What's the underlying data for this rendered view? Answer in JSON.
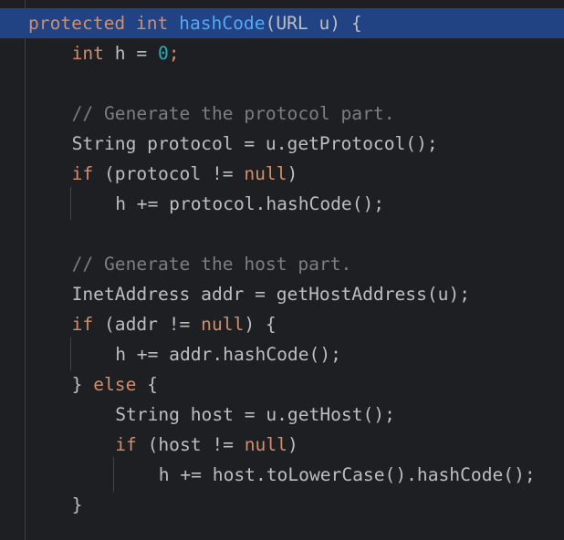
{
  "editor": {
    "lines": [
      {
        "id": "line-1",
        "current": true,
        "indent": 0,
        "tokens": [
          {
            "t": "protected",
            "c": "kw"
          },
          {
            "t": " ",
            "c": "pl"
          },
          {
            "t": "int",
            "c": "kw"
          },
          {
            "t": " ",
            "c": "pl"
          },
          {
            "t": "hashCode",
            "c": "fn"
          },
          {
            "t": "(URL u) {",
            "c": "pl"
          }
        ]
      },
      {
        "id": "line-2",
        "indent": 1,
        "tokens": [
          {
            "t": "int",
            "c": "kw"
          },
          {
            "t": " h = ",
            "c": "pl"
          },
          {
            "t": "0",
            "c": "num"
          },
          {
            "t": ";",
            "c": "kw"
          }
        ]
      },
      {
        "id": "line-3",
        "indent": 0,
        "tokens": []
      },
      {
        "id": "line-4",
        "indent": 1,
        "tokens": [
          {
            "t": "// Generate the protocol part.",
            "c": "cm"
          }
        ]
      },
      {
        "id": "line-5",
        "indent": 1,
        "tokens": [
          {
            "t": "String protocol = u.getProtocol();",
            "c": "pl"
          }
        ]
      },
      {
        "id": "line-6",
        "indent": 1,
        "tokens": [
          {
            "t": "if",
            "c": "kw"
          },
          {
            "t": " (protocol != ",
            "c": "pl"
          },
          {
            "t": "null",
            "c": "kw"
          },
          {
            "t": ")",
            "c": "pl"
          }
        ]
      },
      {
        "id": "line-7",
        "indent": 2,
        "tokens": [
          {
            "t": "h += protocol.hashCode();",
            "c": "pl"
          }
        ]
      },
      {
        "id": "line-8",
        "indent": 0,
        "tokens": []
      },
      {
        "id": "line-9",
        "indent": 1,
        "tokens": [
          {
            "t": "// Generate the host part.",
            "c": "cm"
          }
        ]
      },
      {
        "id": "line-10",
        "indent": 1,
        "tokens": [
          {
            "t": "InetAddress addr = getHostAddress(u);",
            "c": "pl"
          }
        ]
      },
      {
        "id": "line-11",
        "indent": 1,
        "tokens": [
          {
            "t": "if",
            "c": "kw"
          },
          {
            "t": " (addr != ",
            "c": "pl"
          },
          {
            "t": "null",
            "c": "kw"
          },
          {
            "t": ") {",
            "c": "pl"
          }
        ]
      },
      {
        "id": "line-12",
        "indent": 2,
        "tokens": [
          {
            "t": "h += addr.hashCode();",
            "c": "pl"
          }
        ]
      },
      {
        "id": "line-13",
        "indent": 1,
        "tokens": [
          {
            "t": "} ",
            "c": "pl"
          },
          {
            "t": "else",
            "c": "kw"
          },
          {
            "t": " {",
            "c": "pl"
          }
        ]
      },
      {
        "id": "line-14",
        "indent": 2,
        "tokens": [
          {
            "t": "String host = u.getHost();",
            "c": "pl"
          }
        ]
      },
      {
        "id": "line-15",
        "indent": 2,
        "tokens": [
          {
            "t": "if",
            "c": "kw"
          },
          {
            "t": " (host != ",
            "c": "pl"
          },
          {
            "t": "null",
            "c": "kw"
          },
          {
            "t": ")",
            "c": "pl"
          }
        ]
      },
      {
        "id": "line-16",
        "indent": 3,
        "tokens": [
          {
            "t": "h += host.toLowerCase().hashCode();",
            "c": "pl"
          }
        ]
      },
      {
        "id": "line-17",
        "indent": 1,
        "tokens": [
          {
            "t": "}",
            "c": "pl"
          }
        ]
      }
    ]
  },
  "colors": {
    "background": "#1e1f22",
    "current_line": "#214283",
    "keyword": "#cf8e6d",
    "function": "#56a8f5",
    "number": "#2aacb8",
    "comment": "#7a7e85",
    "plain": "#bcbec4"
  }
}
